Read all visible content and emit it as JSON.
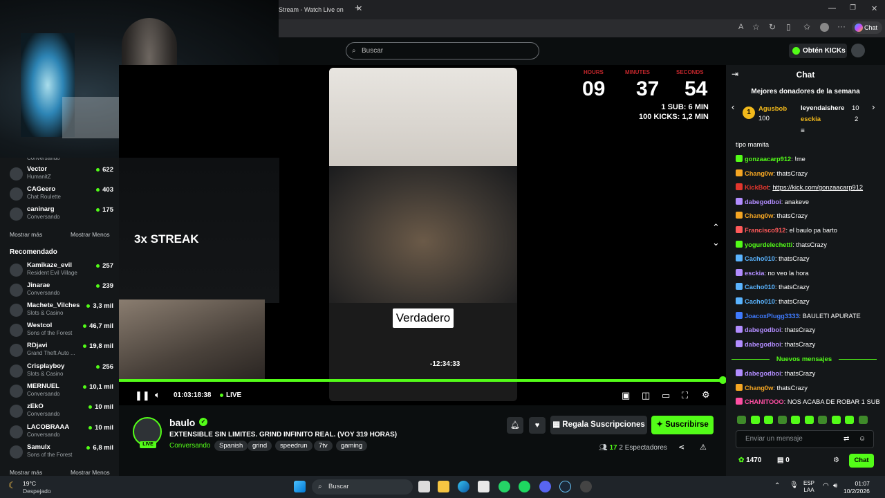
{
  "browser": {
    "tab_title": "Stream - Watch Live on",
    "chat_btn": "Chat"
  },
  "header": {
    "search_placeholder": "Buscar",
    "kicks_label": "Obtén KICKs"
  },
  "sidebar": {
    "top_item_sub": "Conversando",
    "following": [
      {
        "name": "Vector",
        "sub": "HumanitZ",
        "count": "622"
      },
      {
        "name": "CAGeero",
        "sub": "Chat Roulette",
        "count": "403"
      },
      {
        "name": "caninarg",
        "sub": "Conversando",
        "count": "175"
      }
    ],
    "show_more": "Mostrar más",
    "show_less": "Mostrar Menos",
    "recommended_title": "Recomendado",
    "recommended": [
      {
        "name": "Kamikaze_evil",
        "sub": "Resident Evil Village",
        "count": "257"
      },
      {
        "name": "Jinarae",
        "sub": "Conversando",
        "count": "239"
      },
      {
        "name": "Machete_Vilches",
        "sub": "Slots & Casino",
        "count": "3,3 mil"
      },
      {
        "name": "Westcol",
        "sub": "Sons of the Forest",
        "count": "46,7 mil"
      },
      {
        "name": "RDjavi",
        "sub": "Grand Theft Auto ...",
        "count": "19,8 mil"
      },
      {
        "name": "Crisplayboy",
        "sub": "Slots & Casino",
        "count": "256"
      },
      {
        "name": "MERNUEL",
        "sub": "Conversando",
        "count": "10,1 mil"
      },
      {
        "name": "zEkO",
        "sub": "Conversando",
        "count": "10 mil"
      },
      {
        "name": "LACOBRAAA",
        "sub": "Conversando",
        "count": "10 mil"
      },
      {
        "name": "Samulx",
        "sub": "Sons of the Forest",
        "count": "6,8 mil"
      }
    ]
  },
  "video": {
    "overlay_streak": "3x STREAK",
    "verdadero": "Verdadero",
    "timer_labels": [
      "HOURS",
      "MINUTES",
      "SECONDS"
    ],
    "timer_hours": "09",
    "timer_minutes": "37",
    "timer_seconds": "54",
    "timer_line1": "1 SUB: 6 MIN",
    "timer_line2": "100 KICKS: 1,2 MIN",
    "hover_time": "-12:34:33",
    "elapsed": "01:03:18:38",
    "live": "LIVE",
    "progress": 1.0
  },
  "stream": {
    "streamer": "baulo",
    "live_badge": "LIVE",
    "title": "EXTENSIBLE SIN LIMITES. GRIND INFINITO REAL. (VOY 319 HORAS)",
    "category": "Conversando",
    "tags": [
      "Spanish",
      "grind",
      "speedrun",
      "7tv",
      "gaming"
    ],
    "gift_label": "Regala Suscripciones",
    "subscribe_label": "Suscribirse",
    "viewers": "17",
    "viewers_suffix": "2 Espectadores"
  },
  "chat": {
    "title": "Chat",
    "donors_title": "Mejores donadores de la semana",
    "donors": [
      {
        "rank": "1",
        "name": "Agusbob",
        "amount": "100"
      },
      {
        "name": "leyendaishere",
        "amount": "10"
      },
      {
        "name": "esckia",
        "amount": "2"
      }
    ],
    "partial_top": "tipo mamita",
    "messages": [
      {
        "user": "gonzaacarp912",
        "text": "!me",
        "color": "#53fc18"
      },
      {
        "user": "Chang0w",
        "text": "thatsCrazy",
        "color": "#f5a623"
      },
      {
        "user": "KickBot",
        "text": "https://kick.com/gonzaacarp912",
        "color": "#e2362d"
      },
      {
        "user": "dabegodboi",
        "text": "anakeve",
        "color": "#b28dff"
      },
      {
        "user": "Chang0w",
        "text": "thatsCrazy",
        "color": "#f5a623"
      },
      {
        "user": "Francisco912",
        "text": "el baulo pa barto",
        "color": "#ff5a5a"
      },
      {
        "user": "yogurdelechetti",
        "text": "thatsCrazy",
        "color": "#53fc18"
      },
      {
        "user": "Cacho010",
        "text": "thatsCrazy",
        "color": "#5ab4ff"
      },
      {
        "user": "esckia",
        "text": "no veo la hora",
        "color": "#b28dff"
      },
      {
        "user": "Cacho010",
        "text": "thatsCrazy",
        "color": "#5ab4ff"
      },
      {
        "user": "Cacho010",
        "text": "thatsCrazy",
        "color": "#5ab4ff"
      },
      {
        "user": "JoacoxPlugg3333",
        "text": "BAULETI APURATE",
        "color": "#3f7bff"
      },
      {
        "user": "dabegodboi",
        "text": "thatsCrazy",
        "color": "#b28dff"
      },
      {
        "user": "dabegodboi",
        "text": "thatsCrazy",
        "color": "#b28dff"
      }
    ],
    "new_messages": "Nuevos mensajes",
    "new_msgs": [
      {
        "user": "dabegodboi",
        "text": "thatsCrazy",
        "color": "#b28dff"
      },
      {
        "user": "Chang0w",
        "text": "thatsCrazy",
        "color": "#f5a623"
      },
      {
        "user": "CHANITOOO",
        "text": "NOS ACABA DE ROBAR 1 SUB",
        "color": "#ff4fa3"
      }
    ],
    "input_placeholder": "Enviar un mensaje",
    "points": "1470",
    "zero": "0",
    "send_label": "Chat"
  },
  "taskbar": {
    "temp": "19°C",
    "condition": "Despejado",
    "search": "Buscar",
    "lang1": "ESP",
    "lang2": "LAA",
    "time": "01:07",
    "date": "10/2/2026"
  },
  "colors": {
    "accent": "#53fc18",
    "bg": "#0b0e0f",
    "panel": "#141719"
  }
}
